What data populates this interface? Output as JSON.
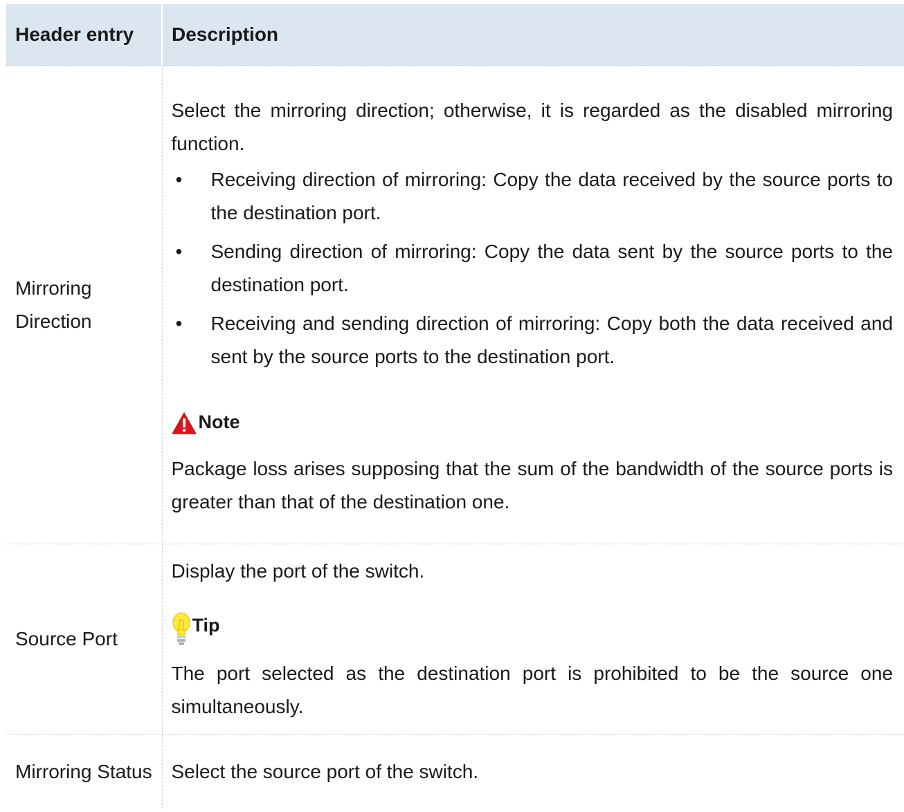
{
  "table": {
    "headers": [
      "Header entry",
      "Description"
    ],
    "rows": [
      {
        "entry": "Mirroring Direction",
        "intro": "Select the mirroring direction; otherwise, it is regarded as the disabled mirroring function.",
        "bullets": [
          "Receiving direction of mirroring: Copy the data received by the source ports to the destination port.",
          "Sending direction of mirroring: Copy the data sent by the source ports to the destination port.",
          "Receiving and sending direction of mirroring: Copy both the data received and sent by the source ports to the destination port."
        ],
        "bullet_symbol": "•",
        "note": {
          "label": "Note",
          "icon": "warning-icon",
          "icon_color": "#e0131b",
          "text": "Package loss arises supposing that the sum of the bandwidth of the source ports is greater than that of the destination one."
        }
      },
      {
        "entry": "Source Port",
        "intro": "Display the port of the switch.",
        "tip": {
          "label": "Tip",
          "icon": "lightbulb-icon",
          "icon_color": "#ffe83a",
          "text": "The port selected as the destination port is prohibited to be the source one simultaneously."
        }
      },
      {
        "entry": "Mirroring Status",
        "description": "Select the source port of the switch."
      }
    ]
  },
  "colors": {
    "header_bg": "#dce6f1",
    "text": "#1a1a1a",
    "row_divider": "#c8c8c8"
  }
}
